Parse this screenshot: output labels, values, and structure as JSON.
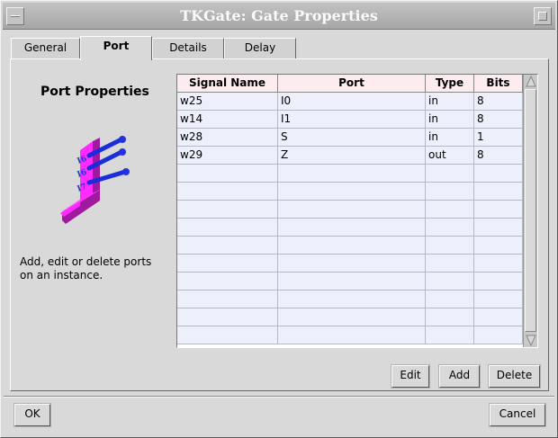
{
  "window": {
    "title": "TKGate: Gate Properties"
  },
  "tabs": [
    {
      "label": "General"
    },
    {
      "label": "Port",
      "active": true
    },
    {
      "label": "Details"
    },
    {
      "label": "Delay"
    }
  ],
  "left_panel": {
    "title": "Port Properties",
    "description": "Add, edit or delete ports on an instance."
  },
  "ports_table": {
    "columns": [
      "Signal Name",
      "Port",
      "Type",
      "Bits"
    ],
    "rows": [
      [
        "w25",
        "I0",
        "in",
        "8"
      ],
      [
        "w14",
        "I1",
        "in",
        "8"
      ],
      [
        "w28",
        "S",
        "in",
        "1"
      ],
      [
        "w29",
        "Z",
        "out",
        "8"
      ],
      [
        "",
        "",
        "",
        ""
      ],
      [
        "",
        "",
        "",
        ""
      ],
      [
        "",
        "",
        "",
        ""
      ],
      [
        "",
        "",
        "",
        ""
      ],
      [
        "",
        "",
        "",
        ""
      ],
      [
        "",
        "",
        "",
        ""
      ],
      [
        "",
        "",
        "",
        ""
      ],
      [
        "",
        "",
        "",
        ""
      ],
      [
        "",
        "",
        "",
        ""
      ],
      [
        "",
        "",
        "",
        ""
      ]
    ]
  },
  "table_actions": {
    "edit": "Edit",
    "add": "Add",
    "delete": "Delete"
  },
  "dialog_actions": {
    "ok": "OK",
    "cancel": "Cancel"
  },
  "colors": {
    "header_bg": "#fdecef",
    "cell_bg": "#edf0fb",
    "icon_bar": "#ff2bff",
    "icon_pins": "#2233dd"
  }
}
